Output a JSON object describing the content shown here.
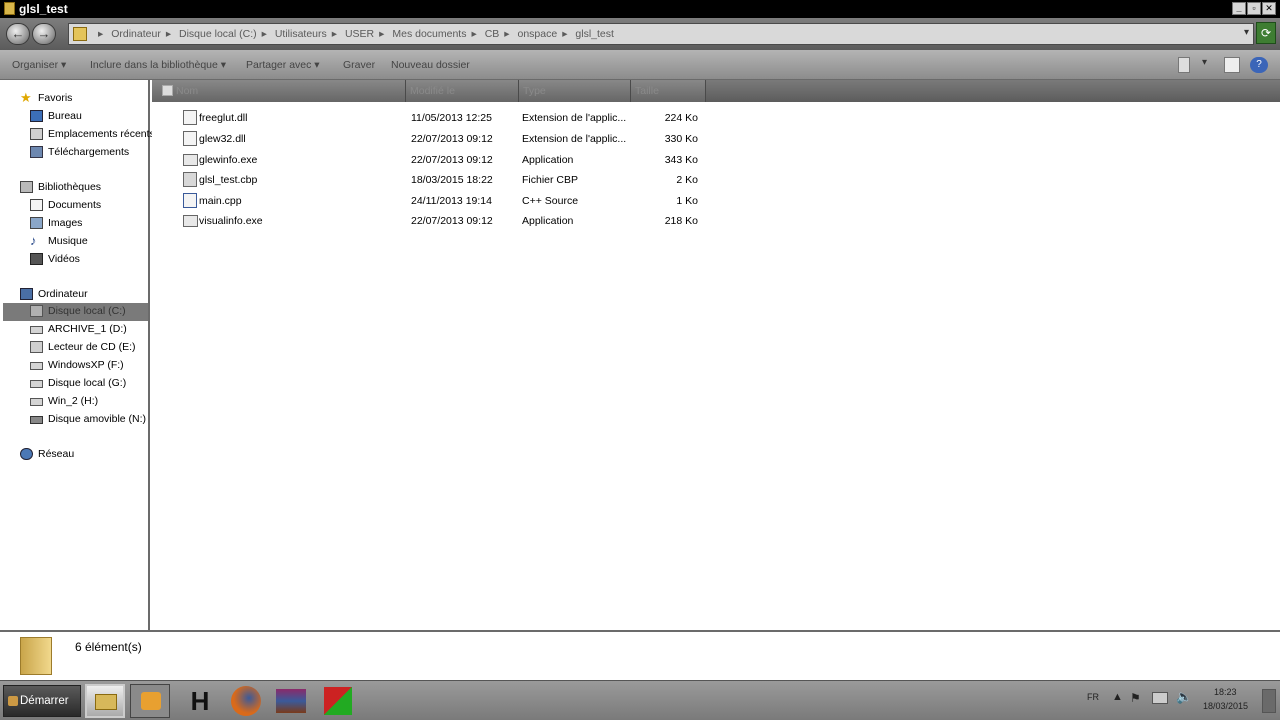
{
  "window": {
    "title": "glsl_test"
  },
  "address": {
    "crumbs": [
      "Ordinateur",
      "Disque local (C:)",
      "Utilisateurs",
      "USER",
      "Mes documents",
      "CB",
      "onspace",
      "glsl_test"
    ]
  },
  "toolbar": {
    "organize": "Organiser",
    "include_library": "Inclure dans la bibliothèque",
    "share": "Partager avec",
    "burn": "Graver",
    "new_folder": "Nouveau dossier"
  },
  "nav": {
    "favorites": {
      "label": "Favoris",
      "items": [
        "Bureau",
        "Emplacements récents",
        "Téléchargements"
      ]
    },
    "libraries": {
      "label": "Bibliothèques",
      "items": [
        "Documents",
        "Images",
        "Musique",
        "Vidéos"
      ]
    },
    "computer": {
      "label": "Ordinateur",
      "items": [
        "Disque local (C:)",
        "ARCHIVE_1 (D:)",
        "Lecteur de CD (E:)",
        "WindowsXP (F:)",
        "Disque local (G:)",
        "Win_2 (H:)",
        "Disque amovible (N:)"
      ]
    },
    "network": {
      "label": "Réseau"
    }
  },
  "columns": {
    "name": "Nom",
    "modified": "Modifié le",
    "type": "Type",
    "size": "Taille"
  },
  "files": [
    {
      "name": "freeglut.dll",
      "modified": "11/05/2013 12:25",
      "type": "Extension de l'applic...",
      "size": "224 Ko"
    },
    {
      "name": "glew32.dll",
      "modified": "22/07/2013 09:12",
      "type": "Extension de l'applic...",
      "size": "330 Ko"
    },
    {
      "name": "glewinfo.exe",
      "modified": "22/07/2013 09:12",
      "type": "Application",
      "size": "343 Ko"
    },
    {
      "name": "glsl_test.cbp",
      "modified": "18/03/2015 18:22",
      "type": "Fichier CBP",
      "size": "2 Ko"
    },
    {
      "name": "main.cpp",
      "modified": "24/11/2013 19:14",
      "type": "C++ Source",
      "size": "1 Ko"
    },
    {
      "name": "visualinfo.exe",
      "modified": "22/07/2013 09:12",
      "type": "Application",
      "size": "218 Ko"
    }
  ],
  "details": {
    "count": "6 élément(s)"
  },
  "taskbar": {
    "start": "Démarrer",
    "h_app": "H",
    "lang": "FR",
    "time": "18:23",
    "date": "18/03/2015"
  }
}
